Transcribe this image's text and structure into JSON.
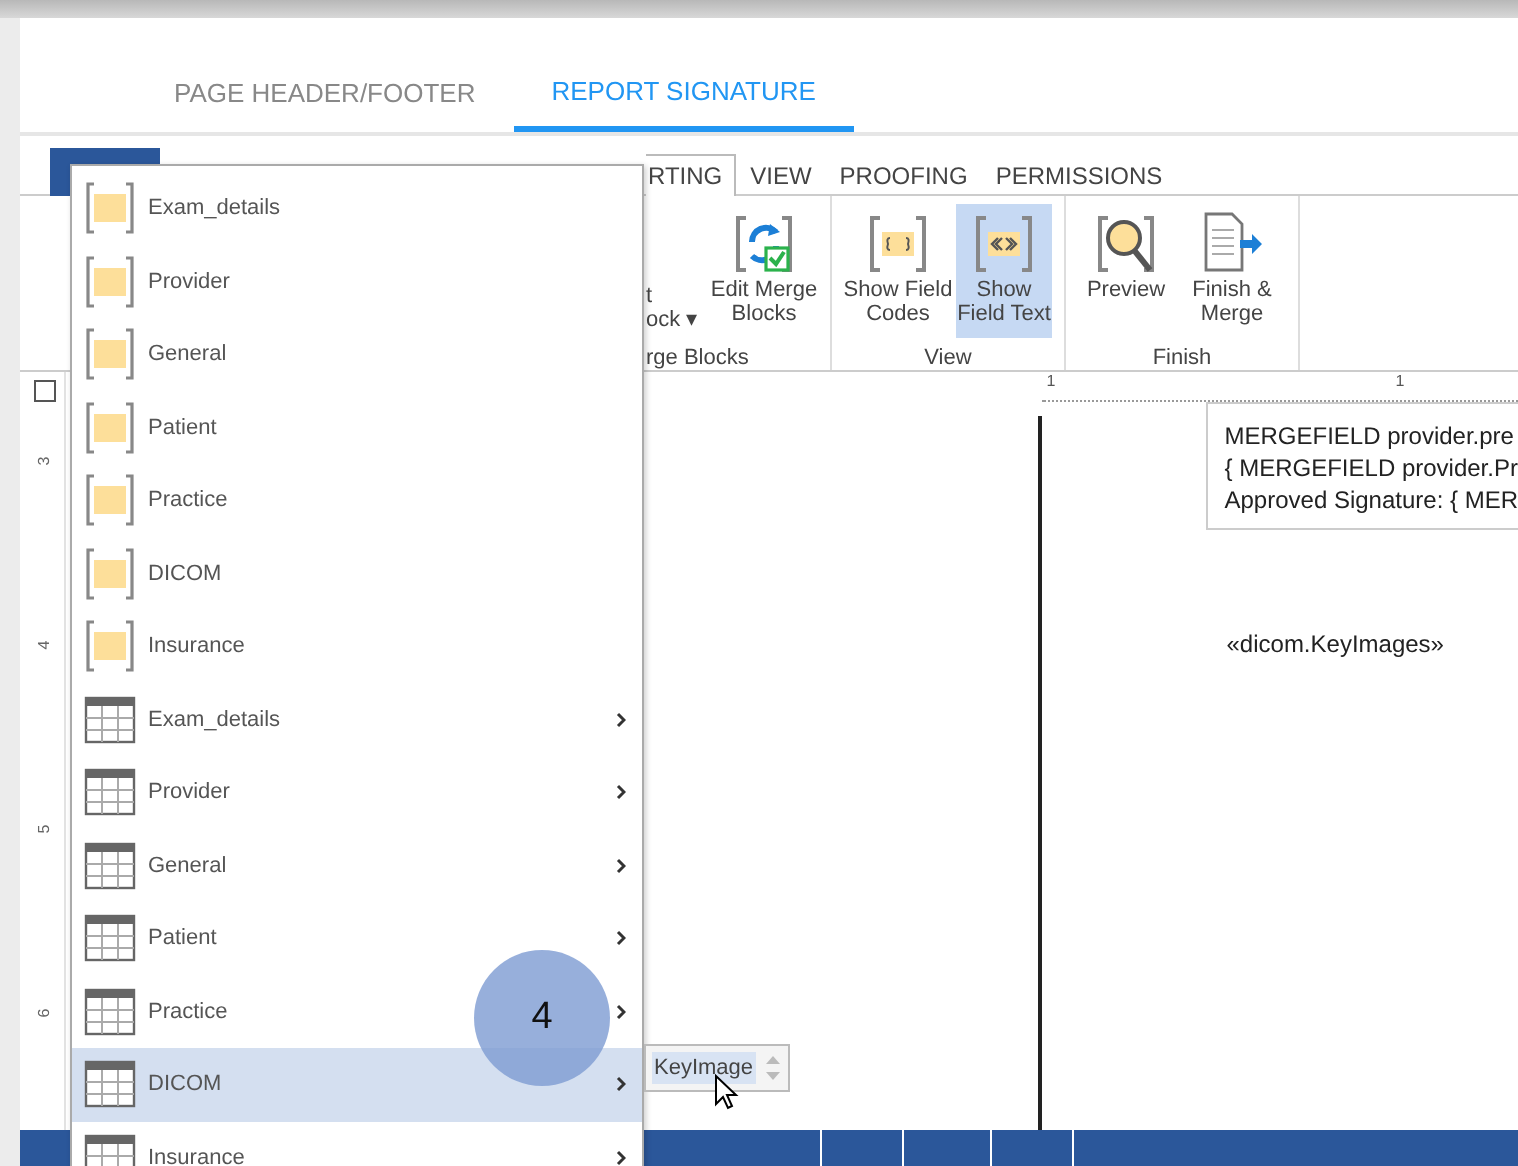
{
  "tabs": [
    {
      "label": "PAGE HEADER/FOOTER",
      "selected": false
    },
    {
      "label": "REPORT SIGNATURE",
      "selected": true
    }
  ],
  "ribbon": {
    "tabs": [
      {
        "label": "RTING",
        "selected": true
      },
      {
        "label": "VIEW",
        "selected": false
      },
      {
        "label": "PROOFING",
        "selected": false
      },
      {
        "label": "PERMISSIONS",
        "selected": false
      }
    ],
    "groups": [
      {
        "label": "rge Blocks",
        "buttons": [
          {
            "kind": "insert",
            "lines": [
              "t",
              "ock ▾"
            ],
            "selected": false
          },
          {
            "kind": "edit",
            "lines": [
              "Edit Merge",
              "Blocks"
            ],
            "selected": false
          }
        ]
      },
      {
        "label": "View",
        "buttons": [
          {
            "kind": "codes",
            "lines": [
              "Show Field",
              "Codes"
            ],
            "selected": false
          },
          {
            "kind": "text",
            "lines": [
              "Show",
              "Field Text"
            ],
            "selected": true
          }
        ]
      },
      {
        "label": "Finish",
        "buttons": [
          {
            "kind": "preview",
            "lines": [
              "Preview"
            ],
            "selected": false
          },
          {
            "kind": "finish",
            "lines": [
              "Finish &",
              "Merge"
            ],
            "selected": false
          }
        ]
      }
    ]
  },
  "vertical_ruler": [
    "3",
    "4",
    "5",
    "6"
  ],
  "horizontal_ruler": [
    "1",
    "1"
  ],
  "document": {
    "text_box_lines": [
      "MERGEFIELD provider.pre",
      "{ MERGEFIELD provider.Pr",
      "Approved Signature: { MER"
    ],
    "field": "«dicom.KeyImages»"
  },
  "menu": {
    "items": [
      {
        "kind": "block",
        "label": "Exam_details",
        "selected": false
      },
      {
        "kind": "block",
        "label": "Provider",
        "selected": false
      },
      {
        "kind": "block",
        "label": "General",
        "selected": false
      },
      {
        "kind": "block",
        "label": "Patient",
        "selected": false
      },
      {
        "kind": "block",
        "label": "Practice",
        "selected": false
      },
      {
        "kind": "block",
        "label": "DICOM",
        "selected": false
      },
      {
        "kind": "block",
        "label": "Insurance",
        "selected": false
      },
      {
        "kind": "table",
        "label": "Exam_details",
        "selected": false
      },
      {
        "kind": "table",
        "label": "Provider",
        "selected": false
      },
      {
        "kind": "table",
        "label": "General",
        "selected": false
      },
      {
        "kind": "table",
        "label": "Patient",
        "selected": false
      },
      {
        "kind": "table",
        "label": "Practice",
        "selected": false
      },
      {
        "kind": "table",
        "label": "DICOM",
        "selected": true
      },
      {
        "kind": "table",
        "label": "Insurance",
        "selected": false
      }
    ]
  },
  "submenu": {
    "label": "KeyImage"
  },
  "step_badge": "4"
}
